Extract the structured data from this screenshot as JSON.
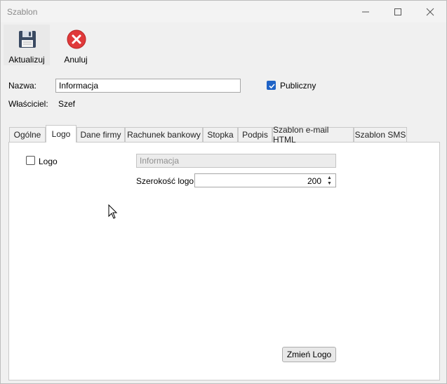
{
  "window": {
    "title": "Szablon"
  },
  "toolbar": {
    "update_label": "Aktualizuj",
    "cancel_label": "Anuluj"
  },
  "form": {
    "name_label": "Nazwa:",
    "name_value": "Informacja",
    "public_label": "Publiczny",
    "public_checked": true,
    "owner_label": "Właściciel:",
    "owner_value": "Szef"
  },
  "tabs": [
    {
      "label": "Ogólne",
      "selected": false
    },
    {
      "label": "Logo",
      "selected": true
    },
    {
      "label": "Dane firmy",
      "selected": false
    },
    {
      "label": "Rachunek bankowy",
      "selected": false
    },
    {
      "label": "Stopka",
      "selected": false
    },
    {
      "label": "Podpis",
      "selected": false
    },
    {
      "label": "Szablon e-mail HTML",
      "selected": false
    },
    {
      "label": "Szablon SMS",
      "selected": false
    }
  ],
  "logo_tab": {
    "logo_checkbox_label": "Logo",
    "logo_checked": false,
    "logo_name_value": "Informacja",
    "width_label": "Szerokość logo:",
    "width_value": "200",
    "change_logo_label": "Zmień Logo"
  },
  "icons": {
    "save": "floppy-disk-icon",
    "cancel": "cancel-x-icon",
    "minimize": "minimize-icon",
    "maximize": "maximize-icon",
    "close": "close-icon"
  },
  "colors": {
    "checkbox_accent": "#1f63c6",
    "cancel_red": "#e0393a"
  }
}
